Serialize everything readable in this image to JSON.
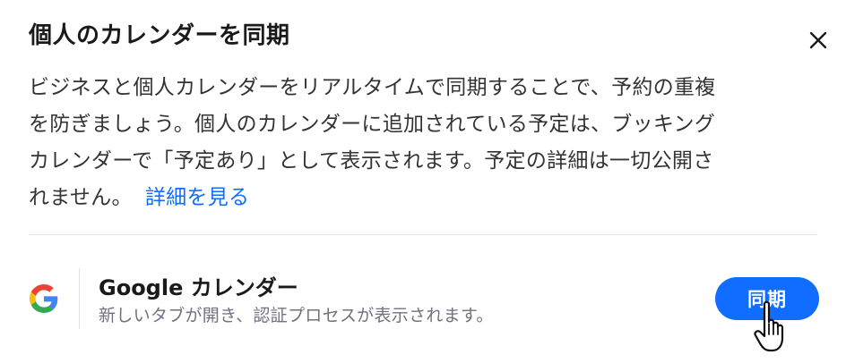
{
  "dialog": {
    "title": "個人のカレンダーを同期",
    "close_icon": "close-icon",
    "description_lines": [
      "ビジネスと個人カレンダーをリアルタイムで同期することで、予約の重複",
      "を防ぎましょう。個人のカレンダーに追加されている予定は、ブッキング",
      "カレンダーで「予定あり」として表示されます。予定の詳細は一切公開さ",
      "れません。"
    ],
    "learn_more_label": "詳細を見る"
  },
  "integration": {
    "logo_icon": "google-logo-icon",
    "title": "Google カレンダー",
    "subtitle": "新しいタブが開き、認証プロセスが表示されます。",
    "sync_label": "同期"
  },
  "colors": {
    "accent": "#116dff",
    "title_text": "#1a1a1a",
    "muted_text": "#6f7380",
    "divider": "#e4e6eb"
  }
}
